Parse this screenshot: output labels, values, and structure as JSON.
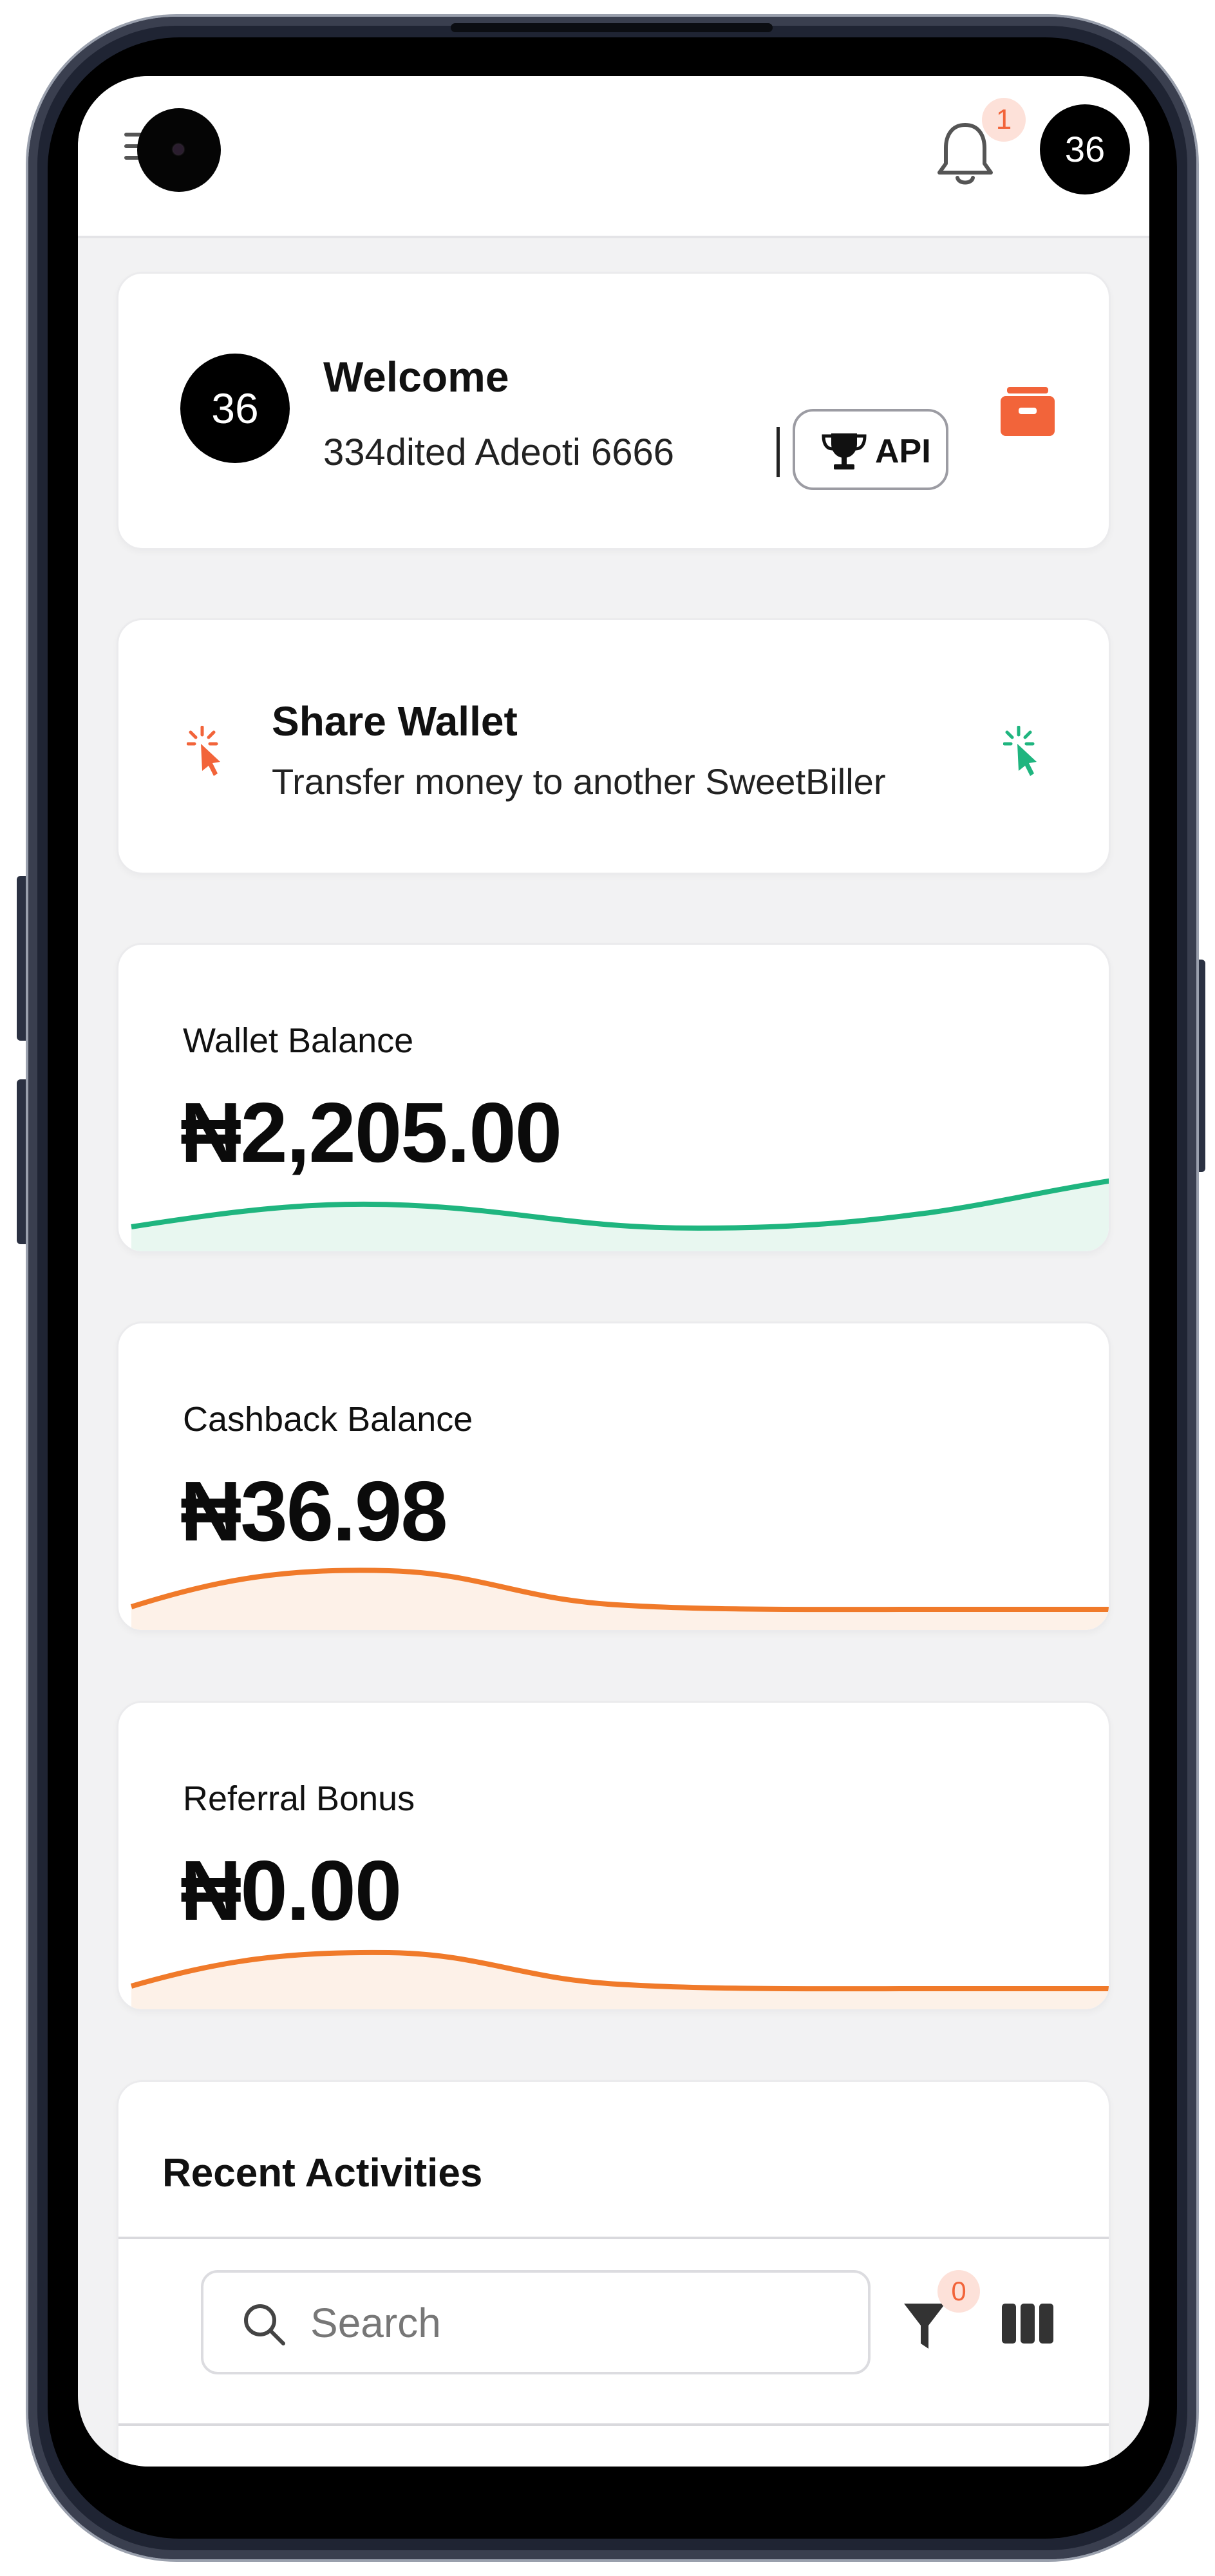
{
  "topbar": {
    "notification_count": "1",
    "avatar_text": "36"
  },
  "welcome": {
    "avatar_text": "36",
    "title": "Welcome",
    "subtitle": "334dited Adeoti 6666",
    "api_label": "API"
  },
  "share_wallet": {
    "title": "Share Wallet",
    "subtitle": "Transfer money to another SweetBiller"
  },
  "balances": [
    {
      "label": "Wallet Balance",
      "amount": "₦2,205.00",
      "color": "#1fb57f"
    },
    {
      "label": "Cashback Balance",
      "amount": "₦36.98",
      "color": "#f07a2a"
    },
    {
      "label": "Referral Bonus",
      "amount": "₦0.00",
      "color": "#f07a2a"
    }
  ],
  "recent": {
    "title": "Recent Activities",
    "search_placeholder": "Search",
    "filter_count": "0"
  },
  "colors": {
    "accent_orange": "#f2643a",
    "accent_green": "#1fb57f",
    "background": "#f2f2f3"
  },
  "icons": [
    "menu-icon",
    "bell-icon",
    "trophy-icon",
    "wallet-icon",
    "click-icon",
    "search-icon",
    "filter-icon",
    "columns-icon"
  ]
}
